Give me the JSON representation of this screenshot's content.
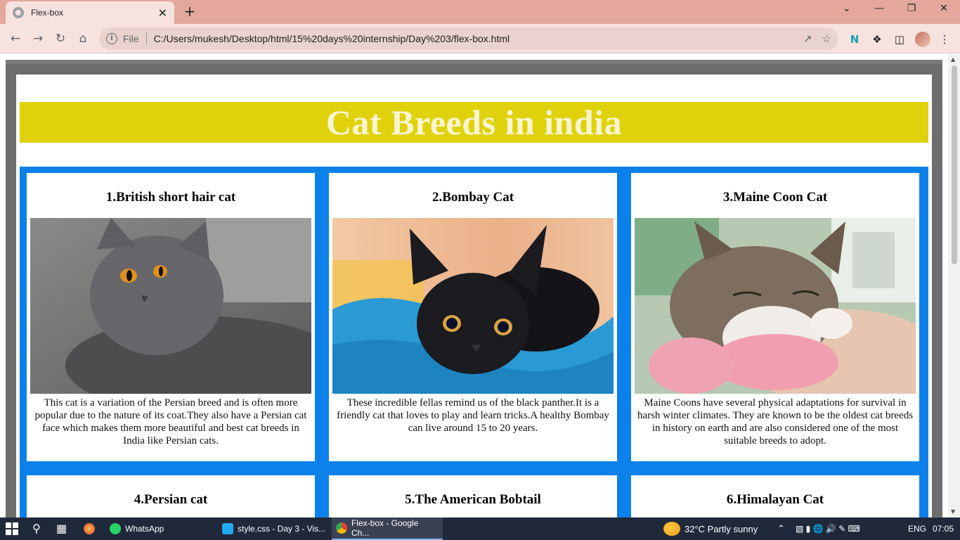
{
  "browser": {
    "tab_title": "Flex-box",
    "tab_close": "✕",
    "new_tab": "+",
    "file_label": "File",
    "url": "C:/Users/mukesh/Desktop/html/15%20days%20internship/Day%203/flex-box.html",
    "window_controls": {
      "dropdown": "⌄",
      "minimize": "—",
      "restore": "❐",
      "close": "✕"
    }
  },
  "page": {
    "heading": "Cat Breeds in india",
    "cards": [
      {
        "title": "1.British short hair cat",
        "text": "This cat is a variation of the Persian breed and is often more popular due to the nature of its coat.They also have a Persian cat face which makes them more beautiful and best cat breeds in India like Persian cats."
      },
      {
        "title": "2.Bombay Cat",
        "text": "These incredible fellas remind us of the black panther.It is a friendly cat that loves to play and learn tricks.A healthy Bombay can live around 15 to 20 years."
      },
      {
        "title": "3.Maine Coon Cat",
        "text": "Maine Coons have several physical adaptations for survival in harsh winter climates. They are known to be the oldest cat breeds in history on earth and are also considered one of the most suitable breeds to adopt."
      },
      {
        "title": "4.Persian cat"
      },
      {
        "title": "5.The American Bobtail"
      },
      {
        "title": "6.Himalayan Cat"
      }
    ]
  },
  "taskbar": {
    "apps": [
      {
        "label": "WhatsApp"
      },
      {
        "label": "style.css - Day 3 - Vis..."
      },
      {
        "label": "Flex-box - Google Ch..."
      }
    ],
    "weather": "32°C  Partly sunny",
    "language": "ENG",
    "time": "07:05"
  },
  "colors": {
    "heading_bg": "#e0d20a",
    "heading_text": "#fbf5d2",
    "grid_bg": "#0d81ea",
    "tab_strip": "#e3a89b"
  }
}
